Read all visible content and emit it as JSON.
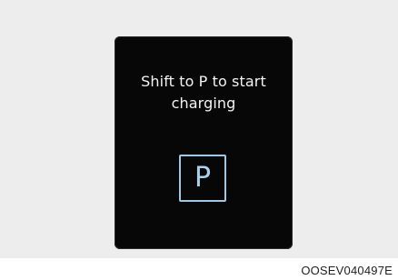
{
  "display": {
    "message_line_1": "Shift to P to start",
    "message_line_2": "charging",
    "gear_label": "P",
    "gear_icon": "p-gear-icon"
  },
  "figure": {
    "code": "OOSEV040497E"
  },
  "colors": {
    "backdrop": "#ededed",
    "panel": "#070707",
    "text": "#f3f3f3",
    "gear_accent": "#9fc8e4"
  }
}
